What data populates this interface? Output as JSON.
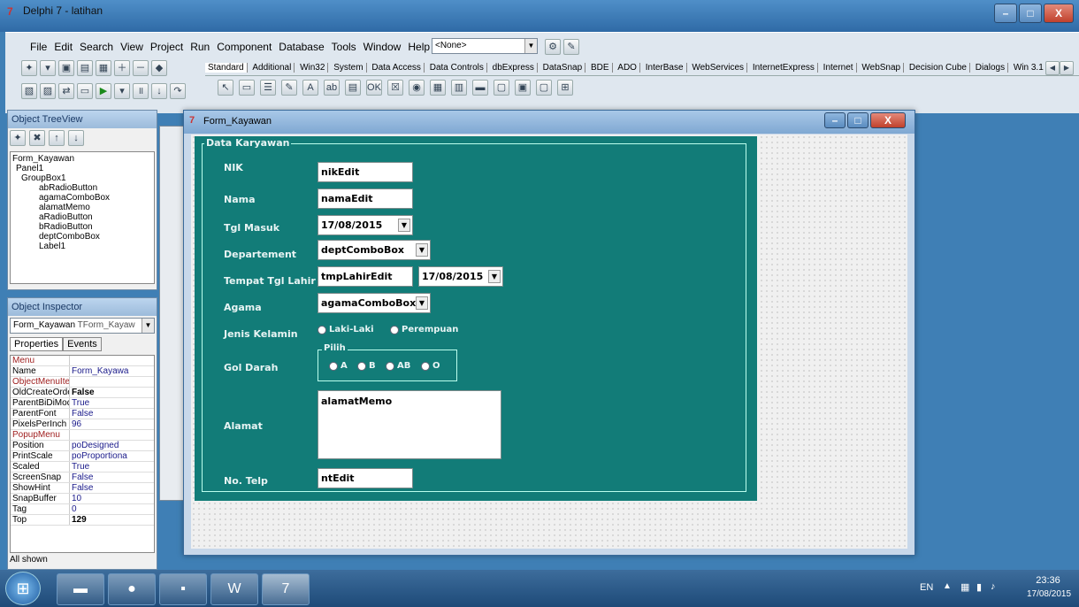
{
  "ide": {
    "title": "Delphi 7 - latihan",
    "window_buttons": {
      "minimize": "–",
      "maximize": "□",
      "close": "X"
    },
    "menu": [
      "File",
      "Edit",
      "Search",
      "View",
      "Project",
      "Run",
      "Component",
      "Database",
      "Tools",
      "Window",
      "Help"
    ],
    "desktop_combo": "<None>",
    "palette_tabs": [
      "Standard",
      "Additional",
      "Win32",
      "System",
      "Data Access",
      "Data Controls",
      "dbExpress",
      "DataSnap",
      "BDE",
      "ADO",
      "InterBase",
      "WebServices",
      "InternetExpress",
      "Internet",
      "WebSnap",
      "Decision Cube",
      "Dialogs",
      "Win 3.1"
    ],
    "palette_components": [
      "↖",
      "▭",
      "☰",
      "✎",
      "A",
      "ab",
      "▤",
      "OK",
      "☒",
      "◉",
      "▦",
      "▥",
      "▬",
      "▢",
      "▣",
      "▢",
      "⊞"
    ]
  },
  "tree_view": {
    "title": "Object TreeView",
    "items": [
      "Form_Kayawan",
      "Panel1",
      "GroupBox1",
      "abRadioButton",
      "agamaComboBox",
      "alamatMemo",
      "aRadioButton",
      "bRadioButton",
      "deptComboBox",
      "Label1"
    ]
  },
  "inspector": {
    "title": "Object Inspector",
    "selected": "Form_Kayawan",
    "selected_type": "TForm_Kayaw",
    "tabs": [
      "Properties",
      "Events"
    ],
    "properties": [
      {
        "k": "Menu",
        "v": "",
        "red": true
      },
      {
        "k": "Name",
        "v": "Form_Kayawa"
      },
      {
        "k": "ObjectMenuItem",
        "v": "",
        "red": true
      },
      {
        "k": "OldCreateOrder",
        "v": "False",
        "bold": true
      },
      {
        "k": "ParentBiDiMode",
        "v": "True"
      },
      {
        "k": "ParentFont",
        "v": "False"
      },
      {
        "k": "PixelsPerInch",
        "v": "96"
      },
      {
        "k": "PopupMenu",
        "v": "",
        "red": true
      },
      {
        "k": "Position",
        "v": "poDesigned"
      },
      {
        "k": "PrintScale",
        "v": "poProportiona"
      },
      {
        "k": "Scaled",
        "v": "True"
      },
      {
        "k": "ScreenSnap",
        "v": "False"
      },
      {
        "k": "ShowHint",
        "v": "False"
      },
      {
        "k": "SnapBuffer",
        "v": "10"
      },
      {
        "k": "Tag",
        "v": "0"
      },
      {
        "k": "Top",
        "v": "129",
        "bold": true
      }
    ],
    "status": "All shown"
  },
  "form": {
    "title": "Form_Kayawan",
    "group_caption": "Data Karyawan",
    "labels": {
      "nik": "NIK",
      "nama": "Nama",
      "tgl_masuk": "Tgl Masuk",
      "departement": "Departement",
      "tempat_tgl_lahir": "Tempat Tgl Lahir",
      "agama": "Agama",
      "jenis_kelamin": "Jenis Kelamin",
      "gol_darah": "Gol Darah",
      "alamat": "Alamat",
      "no_telp": "No. Telp"
    },
    "fields": {
      "nik": "nikEdit",
      "nama": "namaEdit",
      "tgl_masuk": "17/08/2015",
      "departement": "deptComboBox",
      "tempat_lahir": "tmpLahirEdit",
      "tgl_lahir": "17/08/2015",
      "agama": "agamaComboBox",
      "alamat": "alamatMemo",
      "no_telp": "ntEdit"
    },
    "gender_options": [
      "Laki-Laki",
      "Perempuan"
    ],
    "blood_group_caption": "Pilih",
    "blood_options": [
      "A",
      "B",
      "AB",
      "O"
    ]
  },
  "taskbar": {
    "apps": [
      "start",
      "explorer",
      "firefox",
      "cmd",
      "word",
      "delphi"
    ],
    "tray": {
      "lang": "EN",
      "time": "23:36",
      "date": "17/08/2015"
    }
  }
}
